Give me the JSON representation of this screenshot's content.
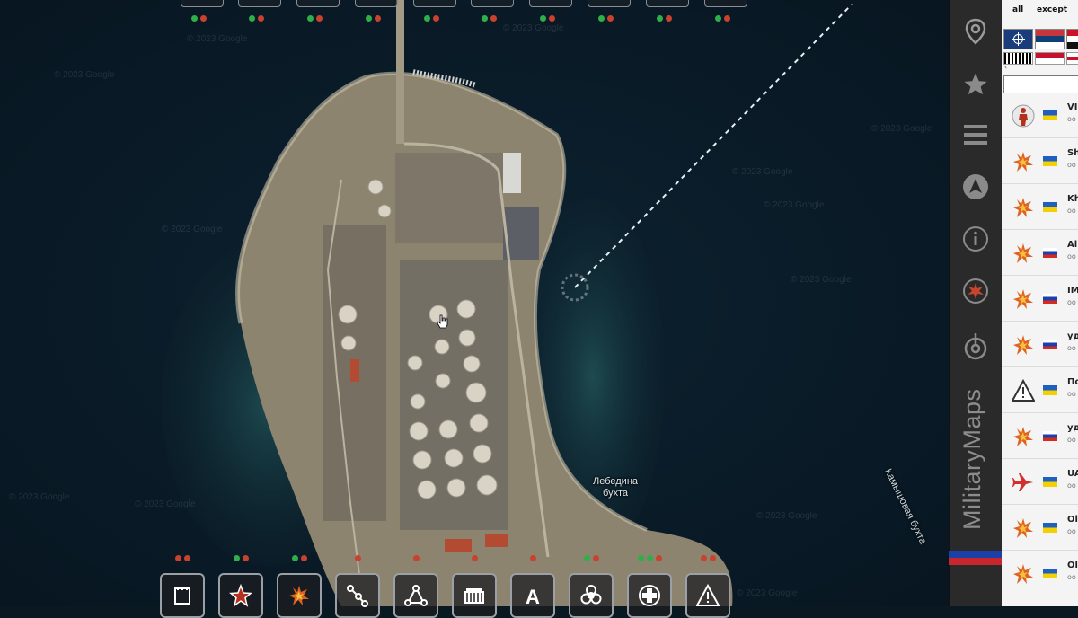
{
  "map": {
    "watermark": "© 2023 Google",
    "labels": {
      "bay_lebedyna": "Лебедина бухта",
      "bay_kamyshovaya": "Камышовая бухта"
    }
  },
  "top_buttons": [
    {
      "status": [
        "green",
        "red"
      ]
    },
    {
      "status": [
        "green",
        "red"
      ]
    },
    {
      "status": [
        "green",
        "red"
      ]
    },
    {
      "status": [
        "green",
        "red"
      ]
    },
    {
      "status": [
        "green",
        "red"
      ]
    },
    {
      "status": [
        "green",
        "red"
      ]
    },
    {
      "status": [
        "green",
        "red"
      ]
    },
    {
      "status": [
        "green",
        "red"
      ]
    },
    {
      "status": [
        "green",
        "red"
      ]
    },
    {
      "status": [
        "green",
        "red"
      ]
    }
  ],
  "bottom_buttons": [
    {
      "icon": "calendar-icon",
      "status": [
        "red",
        "red"
      ]
    },
    {
      "icon": "star-icon",
      "status": [
        "green",
        "red"
      ]
    },
    {
      "icon": "explosion-icon",
      "status": [
        "green",
        "red"
      ]
    },
    {
      "icon": "route-icon",
      "status": [
        "red"
      ]
    },
    {
      "icon": "network-icon",
      "status": [
        "red"
      ]
    },
    {
      "icon": "building-icon",
      "status": [
        "red"
      ]
    },
    {
      "icon": "text-label-icon",
      "status": [
        "red"
      ]
    },
    {
      "icon": "biohazard-icon",
      "status": [
        "green",
        "red"
      ]
    },
    {
      "icon": "medical-cross-icon",
      "status": [
        "green",
        "green",
        "red"
      ]
    },
    {
      "icon": "warning-icon",
      "status": [
        "red",
        "red"
      ]
    }
  ],
  "sidebar": {
    "brand": "MilitaryMaps",
    "icons": [
      "map-pin-icon",
      "star-icon",
      "menu-icon",
      "navigation-icon",
      "info-icon",
      "explosion-circle-icon",
      "target-icon"
    ],
    "brand_bar_colors": [
      "#1d3fa8",
      "#c8262e"
    ]
  },
  "filter_panel": {
    "all_label": "all",
    "except_label": "except"
  },
  "event_list": [
    {
      "icon": "soldier-icon",
      "flag": "ua",
      "name": "VI",
      "sub": "oo"
    },
    {
      "icon": "explosion-icon",
      "flag": "ua",
      "name": "Sh",
      "sub": "oo"
    },
    {
      "icon": "explosion-icon",
      "flag": "ua",
      "name": "Kh",
      "sub": "oo"
    },
    {
      "icon": "explosion-icon",
      "flag": "ru",
      "name": "Al",
      "sub": "oo"
    },
    {
      "icon": "explosion-icon",
      "flag": "ru",
      "name": "IM",
      "sub": "oo"
    },
    {
      "icon": "explosion-icon",
      "flag": "ru",
      "name": "уд",
      "sub": "oo"
    },
    {
      "icon": "warning-icon",
      "flag": "ua",
      "name": "По",
      "sub": "oo"
    },
    {
      "icon": "explosion-icon",
      "flag": "ru",
      "name": "уд",
      "sub": "oo"
    },
    {
      "icon": "jet-icon",
      "flag": "ua",
      "name": "UA",
      "sub": "oo"
    },
    {
      "icon": "explosion-icon",
      "flag": "ua",
      "name": "Ol",
      "sub": "oo"
    },
    {
      "icon": "explosion-icon",
      "flag": "ua",
      "name": "Ol",
      "sub": "oo"
    }
  ]
}
